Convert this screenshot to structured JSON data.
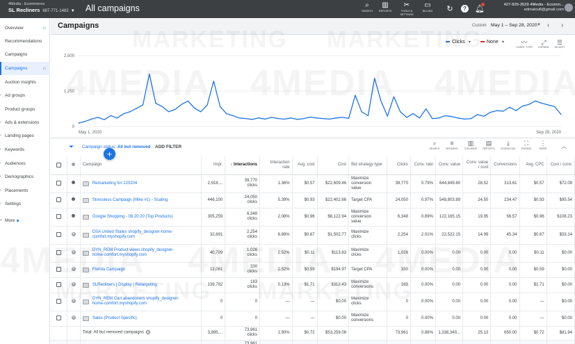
{
  "topbar": {
    "account_line1": "4Media - Ecommerce",
    "account_name": "SL Recliners",
    "account_phone": "687-771-1482",
    "title": "All campaigns",
    "tools": [
      {
        "label": "SEARCH",
        "icon": "search-icon"
      },
      {
        "label": "REPORTS",
        "icon": "reports-icon"
      },
      {
        "label": "TOOLS & SETTINGS",
        "icon": "wrench-icon"
      },
      {
        "label": "BILLING",
        "icon": "billing-icon"
      }
    ],
    "user_line1": "427-826-3529 4Media - Ecomm...",
    "user_email": "edmaloufi@gmail.com"
  },
  "sidebar": {
    "items": [
      {
        "label": "Overview",
        "chev": false
      },
      {
        "label": "Recommendations",
        "chev": false
      },
      {
        "label": "Campaigns",
        "chev": false
      },
      {
        "label": "Campaigns",
        "chev": false,
        "selected": true
      },
      {
        "label": "Auction insights",
        "chev": false
      },
      {
        "label": "Ad groups",
        "chev": true
      },
      {
        "label": "Product groups",
        "chev": false
      },
      {
        "label": "Ads & extensions",
        "chev": true
      },
      {
        "label": "Landing pages",
        "chev": true
      },
      {
        "label": "Keywords",
        "chev": true
      },
      {
        "label": "Audiences",
        "chev": true
      },
      {
        "label": "Demographics",
        "chev": true
      },
      {
        "label": "Placements",
        "chev": true
      },
      {
        "label": "Settings",
        "chev": true
      },
      {
        "label": "More",
        "chev": false
      }
    ]
  },
  "header": {
    "title": "Campaigns",
    "date_label": "Custom",
    "date_range": "May 1 – Sep 28, 2020"
  },
  "chart_controls": {
    "metric1": "Clicks",
    "metric2": "None",
    "metric1_color": "#1a73e8",
    "metric2_color": "#d93025",
    "buttons": [
      "CHART TYPE",
      "EXPAND",
      "ADJUST"
    ]
  },
  "chart_data": {
    "type": "line",
    "xlabel": "",
    "ylabel": "",
    "ylim": [
      0,
      2500
    ],
    "yticks": [
      0,
      1250,
      2500
    ],
    "ytick_labels": [
      "0",
      "1,250",
      "2,500"
    ],
    "x_start_label": "May 1, 2020",
    "x_end_label": "Sep 28, 2020",
    "x": [
      "2020-05-01",
      "2020-05-03",
      "2020-05-05",
      "2020-05-07",
      "2020-05-09",
      "2020-05-11",
      "2020-05-13",
      "2020-05-15",
      "2020-05-17",
      "2020-05-19",
      "2020-05-21",
      "2020-05-23",
      "2020-05-25",
      "2020-05-27",
      "2020-05-29",
      "2020-05-31",
      "2020-06-02",
      "2020-06-04",
      "2020-06-06",
      "2020-06-08",
      "2020-06-10",
      "2020-06-12",
      "2020-06-14",
      "2020-06-16",
      "2020-06-18",
      "2020-06-20",
      "2020-06-22",
      "2020-06-24",
      "2020-06-26",
      "2020-06-28",
      "2020-06-30",
      "2020-07-02",
      "2020-07-04",
      "2020-07-06",
      "2020-07-08",
      "2020-07-10",
      "2020-07-12",
      "2020-07-14",
      "2020-07-16",
      "2020-07-18",
      "2020-07-20",
      "2020-07-22",
      "2020-07-24",
      "2020-07-26",
      "2020-07-28",
      "2020-07-30",
      "2020-08-01",
      "2020-08-03",
      "2020-08-05",
      "2020-08-07",
      "2020-08-09",
      "2020-08-11",
      "2020-08-13",
      "2020-08-15",
      "2020-08-17",
      "2020-08-19",
      "2020-08-21",
      "2020-08-23",
      "2020-08-25",
      "2020-08-27",
      "2020-08-29",
      "2020-08-31",
      "2020-09-02",
      "2020-09-04",
      "2020-09-06",
      "2020-09-08",
      "2020-09-10",
      "2020-09-12",
      "2020-09-14",
      "2020-09-16",
      "2020-09-18",
      "2020-09-20",
      "2020-09-22",
      "2020-09-24",
      "2020-09-26",
      "2020-09-28"
    ],
    "series": [
      {
        "values": [
          120,
          180,
          260,
          320,
          240,
          380,
          300,
          450,
          520,
          640,
          760,
          1850,
          820,
          700,
          520,
          600,
          780,
          900,
          650,
          520,
          760,
          1600,
          700,
          450,
          380,
          300,
          280,
          250,
          300,
          260,
          320,
          280,
          260,
          300,
          250,
          280,
          330,
          300,
          280,
          260,
          300,
          320,
          290,
          1100,
          520,
          380,
          1700,
          900,
          360,
          1050,
          520,
          320,
          450,
          300,
          620,
          280,
          300,
          380,
          350,
          300,
          260,
          280,
          420,
          360,
          500,
          560,
          540,
          680,
          560,
          720,
          780,
          900,
          820,
          760,
          700,
          420
        ],
        "color": "#1a73e8"
      }
    ],
    "grid": true
  },
  "table_toolbar": {
    "filter_prefix": "Campaign status:",
    "filter_value": "All but removed",
    "add_filter": "ADD FILTER",
    "buttons": [
      {
        "label": "SEARCH",
        "icon": "search-icon"
      },
      {
        "label": "SEGMENT",
        "icon": "segment-icon"
      },
      {
        "label": "COLUMNS",
        "icon": "columns-icon"
      },
      {
        "label": "REPORTS",
        "icon": "reports-icon"
      },
      {
        "label": "DOWNLOAD",
        "icon": "download-icon"
      },
      {
        "label": "EXPAND",
        "icon": "expand-icon"
      },
      {
        "label": "MORE",
        "icon": "more-icon"
      }
    ]
  },
  "table": {
    "headers": {
      "campaign": "Campaign",
      "impr": "Impr.",
      "interactions": "Interactions",
      "interaction_rate": "Interaction rate",
      "avg_cost": "Avg. cost",
      "cost": "Cost",
      "bid_strategy": "Bid strategy type",
      "clicks": "Clicks",
      "conv_rate": "Conv. rate",
      "conv_value": "Conv. value",
      "conv_value_cost": "Conv. value / cost",
      "conversions": "Conversions",
      "avg_cpc": "Avg. CPC",
      "cost_conv": "Cost / conv."
    },
    "rows": [
      {
        "status": "enabled",
        "name": "Remarketing for 120204",
        "impr": "2,918,...",
        "interactions": "39,770",
        "interactions_unit": "clicks",
        "interaction_rate": "1.36%",
        "avg_cost": "$0.57",
        "cost": "$22,609.46",
        "bid1": "Maximize",
        "bid2": "conversion",
        "bid3": "value",
        "clicks": "39,770",
        "conv_rate": "0.79%",
        "conv_value": "644,849.80",
        "conv_value_cost": "28.52",
        "conversions": "313.61",
        "avg_cpc": "$0.57",
        "cost_conv": "$72.09"
      },
      {
        "status": "enabled",
        "name": "Stressless Campaign (Mike #1) - Scaling",
        "impr": "446,100",
        "interactions": "24,050",
        "interactions_unit": "clicks",
        "interaction_rate": "5.39%",
        "avg_cost": "$0.93",
        "cost": "$22,402.66",
        "bid1": "Target CPA",
        "bid2": "",
        "bid3": "",
        "clicks": "24,050",
        "conv_rate": "0.97%",
        "conv_value": "548,803.89",
        "conv_value_cost": "24.50",
        "conversions": "234.47",
        "avg_cpc": "$0.93",
        "cost_conv": "$95.54"
      },
      {
        "status": "enabled",
        "name": "Google Shopping - 08.20.20 (Top Products)",
        "impr": "305,259",
        "interactions": "6,348",
        "interactions_unit": "clicks",
        "interaction_rate": "2.08%",
        "avg_cost": "$0.96",
        "cost": "$6,122.94",
        "bid1": "Maximize",
        "bid2": "conversion",
        "bid3": "value",
        "clicks": "6,348",
        "conv_rate": "0.89%",
        "conv_value": "122,165.15",
        "conv_value_cost": "19.95",
        "conversions": "56.57",
        "avg_cpc": "$0.96",
        "cost_conv": "$108.23"
      },
      {
        "status": "removed",
        "name": "DSA United States shopify_designer-home-",
        "name2": "comfort.myshopify.com",
        "impr": "32,691",
        "interactions": "2,254",
        "interactions_unit": "clicks",
        "interaction_rate": "6.89%",
        "avg_cost": "$0.67",
        "cost": "$1,502.77",
        "bid1": "Maximize",
        "bid2": "clicks",
        "bid3": "",
        "clicks": "2,254",
        "conv_rate": "2.01%",
        "conv_value": "22,522.15",
        "conv_value_cost": "14.99",
        "conversions": "45.34",
        "avg_cpc": "$0.67",
        "cost_conv": "$33.14"
      },
      {
        "status": "removed",
        "name": "DYN_REM Product views shopify_designer-",
        "name2": "home-comfort.myshopify.com",
        "impr": "40,709",
        "interactions": "1,026",
        "interactions_unit": "clicks",
        "interaction_rate": "2.52%",
        "avg_cost": "$0.11",
        "cost": "$113.83",
        "bid1": "Maximize",
        "bid2": "clicks",
        "bid3": "",
        "clicks": "1,026",
        "conv_rate": "0.00%",
        "conv_value": "0.00",
        "conv_value_cost": "0.00",
        "conversions": "0.00",
        "avg_cpc": "$0.11",
        "cost_conv": "$0.00"
      },
      {
        "status": "removed",
        "name": "Florida Campaign",
        "impr": "13,081",
        "interactions": "330",
        "interactions_unit": "clicks",
        "interaction_rate": "2.52%",
        "avg_cost": "$0.59",
        "cost": "$194.97",
        "bid1": "Target CPA",
        "bid2": "",
        "bid3": "",
        "clicks": "330",
        "conv_rate": "0.00%",
        "conv_value": "0.00",
        "conv_value_cost": "0.00",
        "conversions": "0.00",
        "avg_cpc": "$0.59",
        "cost_conv": "$0.00"
      },
      {
        "status": "removed",
        "name": "SLRecliners | Display | Retargeting",
        "impr": "139,792",
        "interactions": "183",
        "interactions_unit": "clicks",
        "interaction_rate": "0.13%",
        "avg_cost": "$1.71",
        "cost": "$312.43",
        "bid1": "Maximize",
        "bid2": "conversions",
        "bid3": "",
        "clicks": "183",
        "conv_rate": "0.00%",
        "conv_value": "0.00",
        "conv_value_cost": "0.00",
        "conversions": "0.00",
        "avg_cpc": "$1.71",
        "cost_conv": "$0.00"
      },
      {
        "status": "removed",
        "name": "DYN_REM Cart abandoners shopify_designer-",
        "name2": "home-comfort.myshopify.com",
        "impr": "0",
        "interactions": "0",
        "interactions_unit": "",
        "interaction_rate": "—",
        "avg_cost": "—",
        "cost": "$0.00",
        "bid1": "Maximize",
        "bid2": "clicks",
        "bid3": "",
        "clicks": "0",
        "conv_rate": "0.00%",
        "conv_value": "0.00",
        "conv_value_cost": "0.00",
        "conversions": "0.00",
        "avg_cpc": "—",
        "cost_conv": "$0.00"
      },
      {
        "status": "removed",
        "name": "Sales (Product Specific)",
        "impr": "0",
        "interactions": "0",
        "interactions_unit": "",
        "interaction_rate": "—",
        "avg_cost": "—",
        "cost": "$0.00",
        "bid1": "Maximize",
        "bid2": "conversions",
        "bid3": "",
        "clicks": "0",
        "conv_rate": "0.00%",
        "conv_value": "0.00",
        "conv_value_cost": "0.00",
        "conversions": "0.00",
        "avg_cpc": "—",
        "cost_conv": "$0.00"
      }
    ],
    "totals": [
      {
        "label": "Total: All but removed campaigns",
        "impr": "3,895,...",
        "interactions": "73,961",
        "interactions_unit": "clicks",
        "interaction_rate": "1.90%",
        "avg_cost": "$0.72",
        "cost": "$53,259.08",
        "clicks": "73,961",
        "conv_rate": "0.88%",
        "conv_value": "1,338,340...",
        "conv_value_cost": "25.13",
        "conversions": "650.00",
        "avg_cpc": "$0.72",
        "cost_conv": "$81.94"
      },
      {
        "label": "Total: Account",
        "impr": "3,895,...",
        "interactions": "73,961",
        "interactions_unit": "clicks",
        "interaction_rate": "1.90%",
        "avg_cost": "$0.72",
        "cost": "$53,259.08",
        "clicks": "73,961",
        "conv_rate": "0.88%",
        "conv_value": "1,338,340...",
        "conv_value_cost": "25.13",
        "conversions": "650.00",
        "avg_cpc": "$0.72",
        "cost_conv": "$81.94"
      }
    ]
  },
  "watermark": {
    "text1": "4MEDIA",
    "text2": "MARKETING"
  }
}
